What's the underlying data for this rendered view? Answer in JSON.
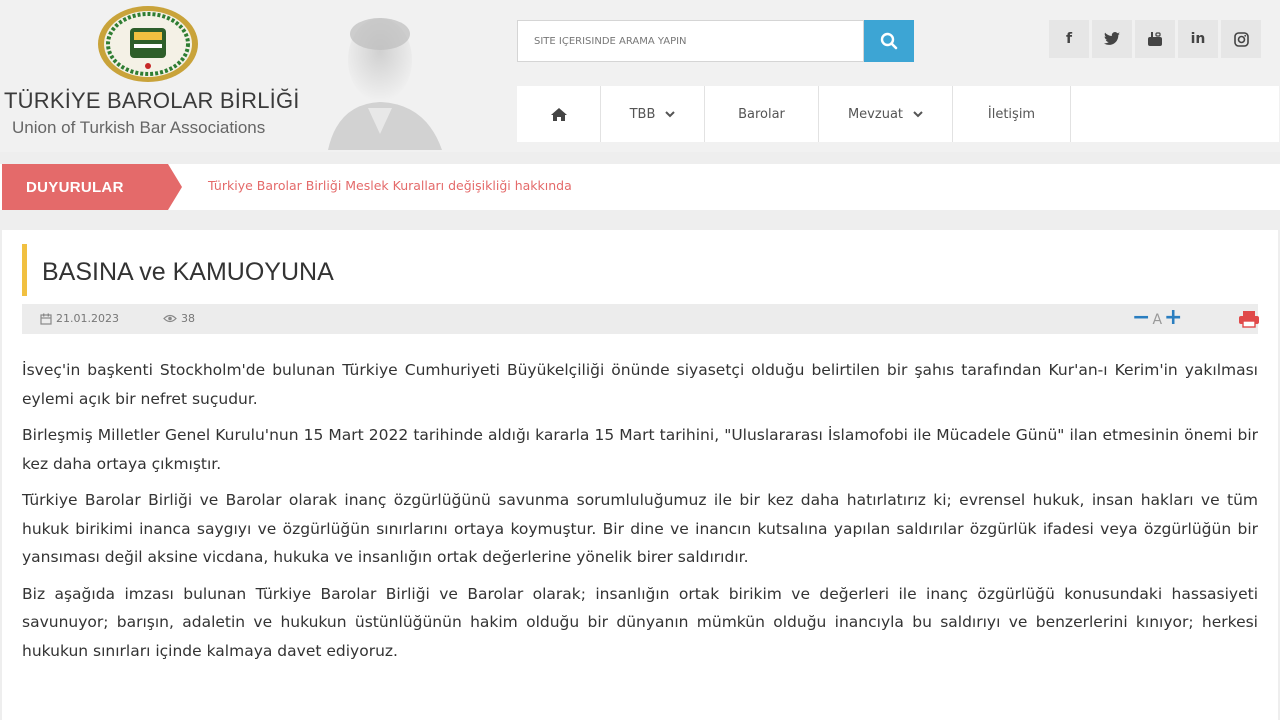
{
  "header": {
    "logo_title": "TÜRKİYE BAROLAR BİRLİĞİ",
    "logo_subtitle": "Union of Turkish Bar Associations",
    "search_placeholder": "SİTE İÇERİSİNDE ARAMA YAPIN",
    "social": [
      {
        "icon": "facebook-icon",
        "glyph": "f"
      },
      {
        "icon": "twitter-icon",
        "glyph": "t"
      },
      {
        "icon": "youtube-icon",
        "glyph": "▶"
      },
      {
        "icon": "linkedin-icon",
        "glyph": "in"
      },
      {
        "icon": "instagram-icon",
        "glyph": "◎"
      }
    ]
  },
  "nav": {
    "home_icon": "home-icon",
    "tbb": "TBB",
    "barolar": "Barolar",
    "mevzuat": "Mevzuat",
    "iletisim": "İletişim"
  },
  "announce": {
    "label": "DUYURULAR",
    "text": "Türkiye Barolar Birliği Meslek Kuralları değişikliği hakkında"
  },
  "article": {
    "title": "BASINA ve KAMUOYUNA",
    "date": "21.01.2023",
    "views": "38",
    "font_minus": "−",
    "font_a": "A",
    "font_plus": "+",
    "paragraphs": [
      "İsveç'in başkenti Stockholm'de bulunan Türkiye Cumhuriyeti Büyükelçiliği önünde siyasetçi olduğu belirtilen bir şahıs tarafından Kur'an-ı Kerim'in yakılması eylemi açık bir nefret suçudur.",
      "Birleşmiş Milletler Genel Kurulu'nun 15 Mart 2022 tarihinde aldığı kararla 15 Mart tarihini, \"Uluslararası İslamofobi ile Mücadele Günü\" ilan etmesinin önemi bir kez daha ortaya çıkmıştır.",
      "Türkiye Barolar Birliği ve Barolar olarak inanç özgürlüğünü savunma sorumluluğumuz ile bir kez daha hatırlatırız ki; evrensel hukuk, insan hakları ve tüm hukuk birikimi inanca saygıyı ve özgürlüğün sınırlarını ortaya koymuştur. Bir dine ve inancın kutsalına yapılan saldırılar özgürlük ifadesi veya özgürlüğün bir yansıması değil aksine vicdana, hukuka ve insanlığın ortak değerlerine yönelik birer saldırıdır.",
      "Biz aşağıda imzası bulunan Türkiye Barolar Birliği ve Barolar olarak; insanlığın ortak birikim ve değerleri ile inanç özgürlüğü konusundaki hassasiyeti savunuyor; barışın, adaletin ve hukukun üstünlüğünün hakim olduğu bir dünyanın mümkün olduğu inancıyla bu saldırıyı ve benzerlerini kınıyor; herkesi hukukun sınırları içinde kalmaya davet ediyoruz."
    ]
  },
  "colors": {
    "accent_blue": "#3da5d4",
    "announce_red": "#e46a6a",
    "title_bar_yellow": "#f1c040",
    "font_ctrl_blue": "#2a7ec0",
    "print_red": "#e04a4a"
  }
}
